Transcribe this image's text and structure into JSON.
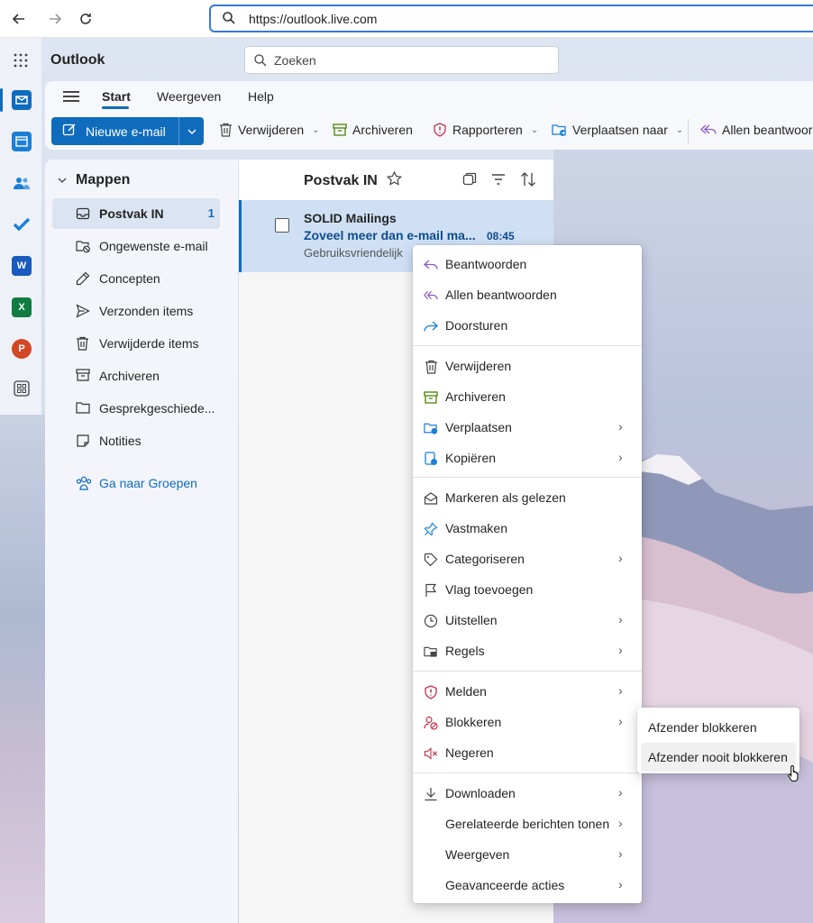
{
  "browser": {
    "url": "https://outlook.live.com"
  },
  "app": {
    "title": "Outlook",
    "search_placeholder": "Zoeken"
  },
  "ribbon": {
    "tabs": [
      "Start",
      "Weergeven",
      "Help"
    ],
    "active_tab": "Start",
    "new_mail": "Nieuwe e-mail",
    "tools": {
      "delete": "Verwijderen",
      "archive": "Archiveren",
      "report": "Rapporteren",
      "move_to": "Verplaatsen naar",
      "reply_all": "Allen beantwoor"
    }
  },
  "folders": {
    "header": "Mappen",
    "items": [
      {
        "label": "Postvak IN",
        "count": "1"
      },
      {
        "label": "Ongewenste e-mail"
      },
      {
        "label": "Concepten"
      },
      {
        "label": "Verzonden items"
      },
      {
        "label": "Verwijderde items"
      },
      {
        "label": "Archiveren"
      },
      {
        "label": "Gesprekgeschiede..."
      },
      {
        "label": "Notities"
      }
    ],
    "groups_link": "Ga naar Groepen"
  },
  "message_list": {
    "title": "Postvak IN",
    "messages": [
      {
        "sender": "SOLID Mailings",
        "subject": "Zoveel meer dan e-mail ma...",
        "time": "08:45",
        "preview": "Gebruiksvriendelijk"
      }
    ]
  },
  "context_menu": {
    "items": [
      {
        "label": "Beantwoorden"
      },
      {
        "label": "Allen beantwoorden"
      },
      {
        "label": "Doorsturen"
      },
      {
        "label": "Verwijderen"
      },
      {
        "label": "Archiveren"
      },
      {
        "label": "Verplaatsen"
      },
      {
        "label": "Kopiëren"
      },
      {
        "label": "Markeren als gelezen"
      },
      {
        "label": "Vastmaken"
      },
      {
        "label": "Categoriseren"
      },
      {
        "label": "Vlag toevoegen"
      },
      {
        "label": "Uitstellen"
      },
      {
        "label": "Regels"
      },
      {
        "label": "Melden"
      },
      {
        "label": "Blokkeren"
      },
      {
        "label": "Negeren"
      },
      {
        "label": "Downloaden"
      },
      {
        "label": "Gerelateerde berichten tonen"
      },
      {
        "label": "Weergeven"
      },
      {
        "label": "Geavanceerde acties"
      }
    ]
  },
  "submenu": {
    "items": [
      "Afzender blokkeren",
      "Afzender nooit blokkeren"
    ],
    "hovered": "Afzender nooit blokkeren"
  },
  "colors": {
    "accent": "#0f6cbd",
    "selected_row": "#cfe0f5",
    "danger": "#c4314b",
    "archive_green": "#498205",
    "reply_purple": "#8a5ac8"
  }
}
